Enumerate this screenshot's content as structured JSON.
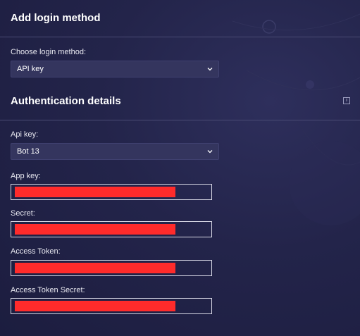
{
  "page": {
    "title": "Add login method"
  },
  "login_method": {
    "label": "Choose login method:",
    "selected": "API key"
  },
  "auth": {
    "title": "Authentication details",
    "api_key_label": "Api key:",
    "api_key_selected": "Bot 13",
    "fields": [
      {
        "label": "App key:"
      },
      {
        "label": "Secret:"
      },
      {
        "label": "Access Token:"
      },
      {
        "label": "Access Token Secret:"
      }
    ]
  },
  "colors": {
    "background": "#23244a",
    "select_bg": "#34355e",
    "redaction": "#ff2b2b",
    "divider": "#4a4b74"
  },
  "icons": {
    "dropdown": "chevron-down-icon",
    "info": "info-icon"
  }
}
